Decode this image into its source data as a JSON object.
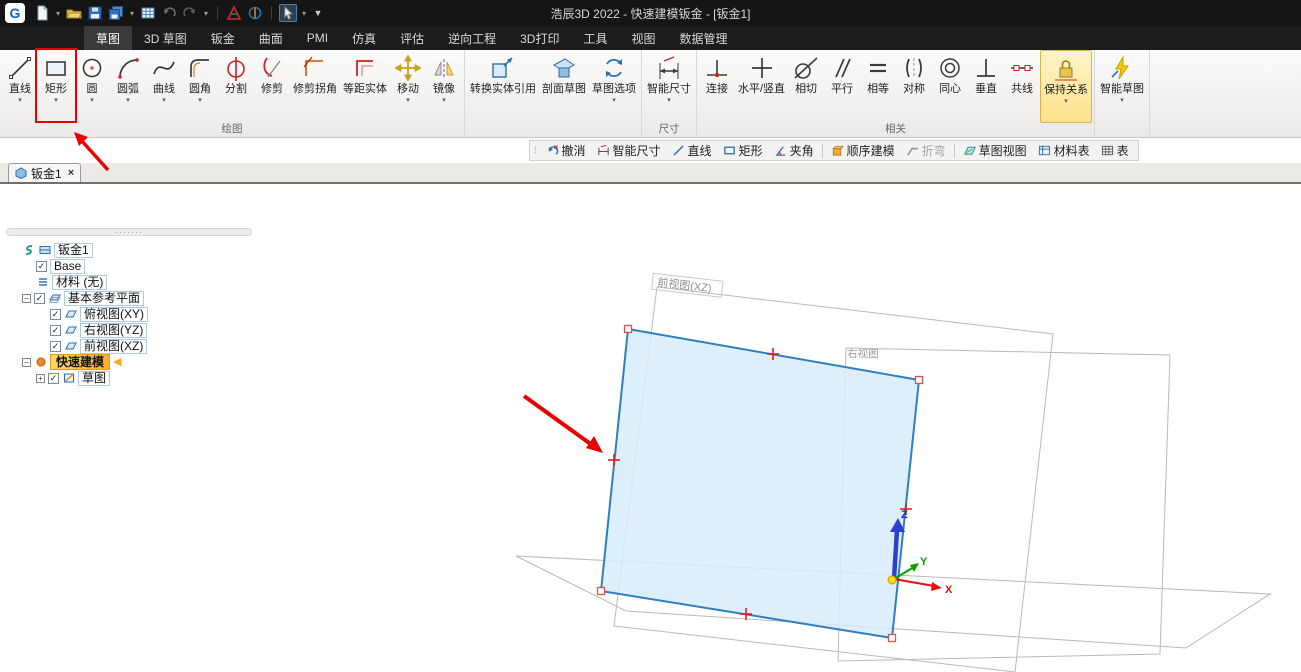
{
  "app": {
    "logo_text": "G",
    "title": "浩辰3D 2022 - 快速建模钣金 - [钣金1]"
  },
  "glyphs": {
    "check": "✓",
    "dropdown": "▾",
    "close": "×",
    "collapse": "−",
    "expand": "+",
    "rollback_arrow": "◀",
    "grip": "⁞",
    "splitter_dots": "·······",
    "window_caret": "▼"
  },
  "menu_tabs": [
    "草图",
    "3D 草图",
    "钣金",
    "曲面",
    "PMI",
    "仿真",
    "评估",
    "逆向工程",
    "3D打印",
    "工具",
    "视图",
    "数据管理"
  ],
  "ribbon": {
    "groups": [
      {
        "label": "绘图",
        "tools": [
          {
            "label": "直线"
          },
          {
            "label": "矩形"
          },
          {
            "label": "圆"
          },
          {
            "label": "圆弧"
          },
          {
            "label": "曲线"
          },
          {
            "label": "圆角"
          },
          {
            "label": "分割"
          },
          {
            "label": "修剪"
          },
          {
            "label": "修剪拐角"
          },
          {
            "label": "等距实体"
          },
          {
            "label": "移动"
          },
          {
            "label": "镜像"
          }
        ]
      },
      {
        "label": "",
        "tools": [
          {
            "label": "转换实体引用"
          },
          {
            "label": "剖面草图"
          },
          {
            "label": "草图选项"
          }
        ]
      },
      {
        "label": "尺寸",
        "tools": [
          {
            "label": "智能尺寸"
          }
        ]
      },
      {
        "label": "相关",
        "tools": [
          {
            "label": "连接"
          },
          {
            "label": "水平/竖直"
          },
          {
            "label": "相切"
          },
          {
            "label": "平行"
          },
          {
            "label": "相等"
          },
          {
            "label": "对称"
          },
          {
            "label": "同心"
          },
          {
            "label": "垂直"
          },
          {
            "label": "共线"
          },
          {
            "label": "保持关系"
          }
        ]
      },
      {
        "label": "",
        "tools": [
          {
            "label": "智能草图"
          }
        ]
      }
    ]
  },
  "quickbar": {
    "items": [
      "撤消",
      "智能尺寸",
      "直线",
      "矩形",
      "夹角",
      "顺序建模",
      "折弯",
      "草图视图",
      "材料表",
      "表"
    ]
  },
  "doc_tab": {
    "label": "钣金1"
  },
  "tree": {
    "root_label": "钣金1",
    "base": "Base",
    "material": "材料 (无)",
    "ref_planes": "基本参考平面",
    "top_view": "俯视图(XY)",
    "right_view": "右视图(YZ)",
    "front_view": "前视图(XZ)",
    "quick_model": "快速建模",
    "sketch": "草图"
  },
  "viewport": {
    "front_plane_label": "前视图(XZ)",
    "right_plane_label": "右视图",
    "axis_x": "X",
    "axis_y": "Y",
    "axis_z": "Z"
  },
  "colors": {
    "annotation_red": "#e60000",
    "sketch_fill": "#d6ecf9",
    "sketch_edge": "#2d7fc1",
    "tool_highlight": "#ffe18a"
  }
}
